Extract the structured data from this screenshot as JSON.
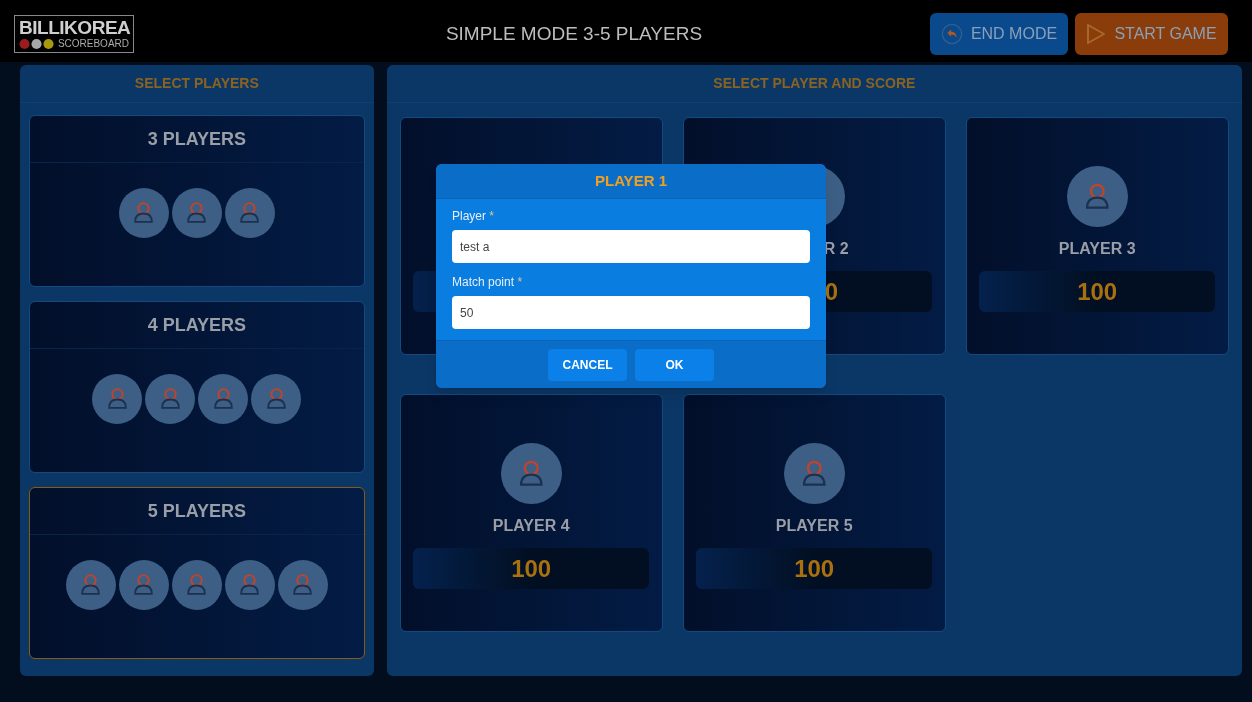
{
  "header": {
    "logo": {
      "brand": "BILLIKOREA",
      "subtitle": "SCOREBOARD"
    },
    "title": "SIMPLE MODE 3-5 PLAYERS",
    "buttons": [
      {
        "kind": "end",
        "label": "END MODE"
      },
      {
        "kind": "start",
        "label": "START GAME"
      }
    ]
  },
  "select_players": {
    "title": "SELECT PLAYERS",
    "options": [
      {
        "label": "3 PLAYERS",
        "selected": false
      },
      {
        "label": "4 PLAYERS",
        "selected": false
      },
      {
        "label": "5 PLAYERS",
        "selected": true
      }
    ]
  },
  "select_score": {
    "title": "SELECT PLAYER AND SCORE",
    "players": [
      {
        "kind": "hidden"
      },
      {
        "kind": "partial",
        "name": "R 2",
        "score": "0"
      },
      {
        "kind": "full",
        "name": "PLAYER 3",
        "score": "100"
      },
      {
        "kind": "full",
        "name": "PLAYER 4",
        "score": "100"
      },
      {
        "kind": "full",
        "name": "PLAYER 5",
        "score": "100"
      }
    ]
  },
  "dialog": {
    "title": "PLAYER 1",
    "fields": [
      {
        "label": "Player",
        "required_mark": "*",
        "value": "test a"
      },
      {
        "label": "Match point",
        "required_mark": "*",
        "value": "50"
      }
    ],
    "buttons": [
      "CANCEL",
      "OK"
    ]
  }
}
